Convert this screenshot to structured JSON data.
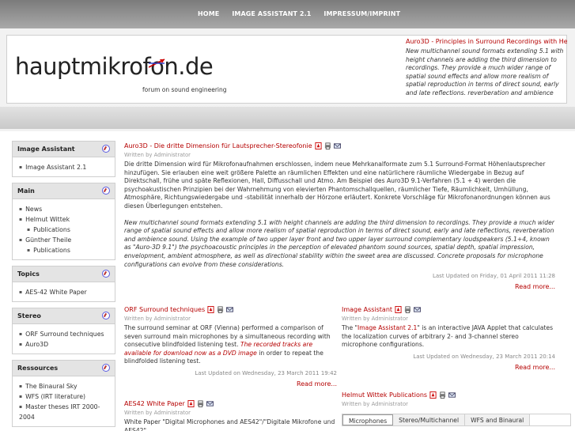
{
  "nav": {
    "items": [
      "HOME",
      "IMAGE ASSISTANT 2.1",
      "IMPRESSUM/IMPRINT"
    ]
  },
  "header": {
    "logo_text_before": "hauptmikrof",
    "logo_text_o": "o",
    "logo_text_after": "n.de",
    "tagline": "forum on sound engineering"
  },
  "feed": {
    "title": "Auro3D - Principles in Surround Recordings with Height",
    "text": "New multichannel sound formats extending 5.1 with height channels are adding the third dimension to recordings. They provide a much wider range of spatial sound effects and allow more realism of spatial reproduction in terms of direct sound, early and late reflections, reverberation and ambience sound. Using"
  },
  "sidebar": {
    "modules": [
      {
        "title": "Image Assistant",
        "items": [
          {
            "label": "Image Assistant 2.1",
            "sub": false
          }
        ]
      },
      {
        "title": "Main",
        "items": [
          {
            "label": "News",
            "sub": false
          },
          {
            "label": "Helmut Wittek",
            "sub": false
          },
          {
            "label": "Publications",
            "sub": true
          },
          {
            "label": "Günther Theile",
            "sub": false
          },
          {
            "label": "Publications",
            "sub": true
          }
        ]
      },
      {
        "title": "Topics",
        "items": [
          {
            "label": "AES-42 White Paper",
            "sub": false
          }
        ]
      },
      {
        "title": "Stereo",
        "items": [
          {
            "label": "ORF Surround techniques",
            "sub": false
          },
          {
            "label": "Auro3D",
            "sub": false
          }
        ]
      },
      {
        "title": "Ressources",
        "items": [
          {
            "label": "The Binaural Sky",
            "sub": false
          },
          {
            "label": "WFS (IRT literature)",
            "sub": false
          },
          {
            "label": "Master theses IRT 2000-2004",
            "sub": false
          }
        ]
      }
    ]
  },
  "main_article": {
    "title": "Auro3D - Die dritte Dimension für Lautsprecher-Stereofonie",
    "meta": "Written by Administrator",
    "body_de": "Die dritte Dimension wird für Mikrofonaufnahmen erschlossen, indem neue Mehrkanalformate zum 5.1 Surround-Format Höhenlautsprecher hinzufügen. Sie erlauben eine weit größere Palette an räumlichen Effekten und eine natürlichere räumliche Wiedergabe in Bezug auf Direktschall, frühe und späte Reflexionen, Hall, Diffusschall und Atmo. Am Beispiel des Auro3D 9.1-Verfahren (5.1 + 4) werden die psychoakustischen Prinzipien bei der Wahrnehmung von elevierten Phantomschallquellen, räumlicher Tiefe, Räumlichkeit, Umhüllung, Atmosphäre, Richtungswiedergabe und -stabilität innerhalb der Hörzone erläutert. Konkrete Vorschläge für Mikrofonanordnungen können aus diesen Überlegungen entstehen.",
    "body_en": "New multichannel sound formats extending 5.1 with height channels are adding the third dimension to recordings. They provide a much wider range of spatial sound effects and allow more realism of spatial reproduction in terms of direct sound, early and late reflections, reverberation and ambience sound. Using the example of two upper layer front and two upper layer surround complementary loudspeakers (5.1+4, known as \"Auro-3D 9.1\") the psychoacoustic principles in the perception of elevated phantom sound sources, spatial depth, spatial impression, envelopment, ambient atmosphere, as well as directional stability within the sweet area are discussed. Concrete proposals for microphone configurations can evolve from these considerations.",
    "updated": "Last Updated on Friday, 01 April 2011 11:28",
    "readmore": "Read more..."
  },
  "orf_article": {
    "title": "ORF Surround techniques",
    "meta": "Written by Administrator",
    "body": "The surround seminar at ORF (Vienna) performed a comparison of seven surround main microphones by a simultaneous recording with consecutive blindfolded listening test.",
    "link": "The recorded tracks are available for download now as a DVD image",
    "body_after": " in order to repeat the blindfolded listening test.",
    "updated": "Last Updated on Wednesday, 23 March 2011 19:42",
    "readmore": "Read more..."
  },
  "aes_article": {
    "title": "AES42 White Paper",
    "meta": "Written by Administrator",
    "body": "White Paper \"Digital Microphones and AES42\"/\"Digitale Mikrofone und AES42\""
  },
  "image_article": {
    "title": "Image Assistant",
    "meta": "Written by Administrator",
    "body_before": "The \"",
    "link": "Image Assistant 2.1",
    "body_after": "\" is an interactive JAVA Applet that calculates the localization curves of arbitrary 2- and 3-channel stereo microphone configurations.",
    "updated": "Last Updated on Wednesday, 23 March 2011 20:14",
    "readmore": "Read more..."
  },
  "wittek_article": {
    "title": "Helmut Wittek Publications",
    "meta": "Written by Administrator",
    "tabs": [
      "Microphones",
      "Stereo/Multichannel",
      "WFS and Binaural"
    ]
  }
}
